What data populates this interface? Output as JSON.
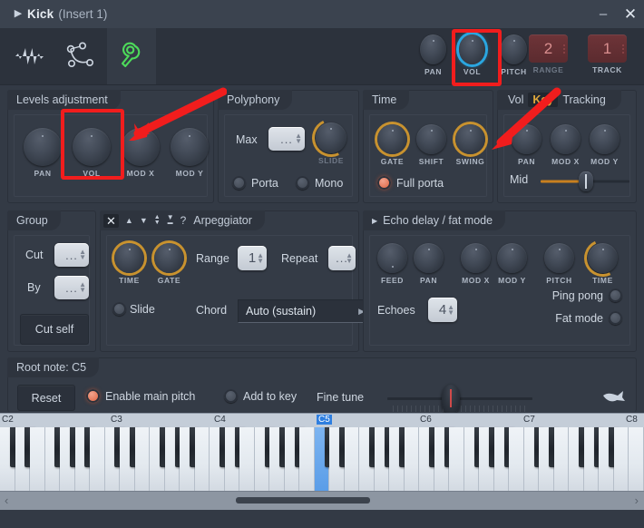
{
  "window": {
    "title": "Kick",
    "subtitle": "(Insert 1)",
    "expand_icon": "triangle-right-icon",
    "minimize_label": "–",
    "close_label": "✕"
  },
  "toolbar": {
    "icons": [
      {
        "name": "waveform-icon",
        "label": "waveform"
      },
      {
        "name": "envelope-icon",
        "label": "envelope"
      },
      {
        "name": "wrench-icon",
        "label": "wrench",
        "active": true
      }
    ],
    "knobs": [
      {
        "name": "pan-knob",
        "label": "PAN"
      },
      {
        "name": "vol-knob",
        "label": "VOL",
        "highlight": "cyan"
      },
      {
        "name": "pitch-knob",
        "label": "PITCH"
      }
    ],
    "range": {
      "label": "RANGE",
      "value": "2"
    },
    "track": {
      "label": "TRACK",
      "value": "1"
    }
  },
  "levels": {
    "title": "Levels adjustment",
    "knobs": [
      {
        "label": "PAN"
      },
      {
        "label": "VOL"
      },
      {
        "label": "MOD X"
      },
      {
        "label": "MOD Y"
      }
    ]
  },
  "polyphony": {
    "title": "Polyphony",
    "max_label": "Max",
    "max_value": "...",
    "slide_label": "SLIDE",
    "porta_label": "Porta",
    "porta_on": false,
    "mono_label": "Mono",
    "mono_on": false
  },
  "time": {
    "title": "Time",
    "knobs": [
      {
        "label": "GATE",
        "ring": "orange"
      },
      {
        "label": "SHIFT",
        "ring": "none"
      },
      {
        "label": "SWING",
        "ring": "orange"
      }
    ],
    "full_porta_label": "Full porta",
    "full_porta_on": true
  },
  "keytracking": {
    "tabs": [
      {
        "label": "Vol",
        "selected": false
      },
      {
        "label": "Key",
        "selected": true
      },
      {
        "label": "Tracking",
        "selected": false
      }
    ],
    "knobs": [
      {
        "label": "PAN"
      },
      {
        "label": "MOD X"
      },
      {
        "label": "MOD Y"
      }
    ],
    "slider_label": "Mid",
    "slider_value": 50
  },
  "group": {
    "title": "Group",
    "cut_label": "Cut",
    "cut_value": "...",
    "by_label": "By",
    "by_value": "...",
    "cut_self_label": "Cut self"
  },
  "arpeggiator": {
    "title": "Arpeggiator",
    "mode_icons": [
      {
        "name": "arp-off-icon",
        "glyph": "✕",
        "active": true
      },
      {
        "name": "arp-up-icon",
        "glyph": "▲",
        "active": false
      },
      {
        "name": "arp-down-icon",
        "glyph": "▼",
        "active": false
      },
      {
        "name": "arp-updown-icon",
        "glyph": "updown",
        "active": false
      },
      {
        "name": "arp-updown-bounce-icon",
        "glyph": "bounce",
        "active": false
      },
      {
        "name": "arp-random-icon",
        "glyph": "?",
        "active": false
      }
    ],
    "knobs": [
      {
        "label": "TIME",
        "ring": "orange"
      },
      {
        "label": "GATE",
        "ring": "orange"
      }
    ],
    "range_label": "Range",
    "range_value": "1",
    "repeat_label": "Repeat",
    "repeat_value": "...",
    "slide_label": "Slide",
    "slide_on": false,
    "chord_label": "Chord",
    "chord_value": "Auto (sustain)"
  },
  "echo": {
    "title": "Echo delay / fat mode",
    "expand_icon": "triangle-right-icon",
    "knobs": [
      {
        "label": "FEED"
      },
      {
        "label": "PAN"
      },
      {
        "label": "MOD X"
      },
      {
        "label": "MOD Y"
      },
      {
        "label": "PITCH"
      },
      {
        "label": "TIME",
        "ring": "orange"
      }
    ],
    "echoes_label": "Echoes",
    "echoes_value": "4",
    "ping_pong_label": "Ping pong",
    "ping_pong_on": false,
    "fat_mode_label": "Fat mode",
    "fat_mode_on": false
  },
  "rootnote": {
    "title": "Root note: C5",
    "reset_label": "Reset",
    "enable_main_pitch_label": "Enable main pitch",
    "enable_main_pitch_on": true,
    "add_to_key_label": "Add to key",
    "add_to_key_on": false,
    "fine_tune_label": "Fine tune",
    "fine_tune_value": 50,
    "hand_icon": "hand-pointer-icon"
  },
  "keyboard": {
    "octave_labels": [
      "C2",
      "C3",
      "C4",
      "C5",
      "C6",
      "C7",
      "C8"
    ],
    "selected_label": "C5",
    "selected_key": "C5",
    "scroll_left_icon": "chevron-left-icon",
    "scroll_right_icon": "chevron-right-icon"
  },
  "annotations": {
    "red_boxes": [
      {
        "name": "vol-knob-top-highlight"
      },
      {
        "name": "vol-knob-levels-highlight"
      }
    ],
    "arrows": [
      {
        "name": "arrow-to-levels-vol"
      },
      {
        "name": "arrow-to-keytracking-pan"
      }
    ],
    "color": "#f11d1d"
  },
  "colors": {
    "accent_cyan": "#2aa6e0",
    "accent_orange": "#c8922f",
    "accent_red": "#f11d1d",
    "panel_bg": "#343b46",
    "window_bg": "#333a45",
    "led_on": "#d9552f",
    "key_sel": "#2f7fe0"
  }
}
